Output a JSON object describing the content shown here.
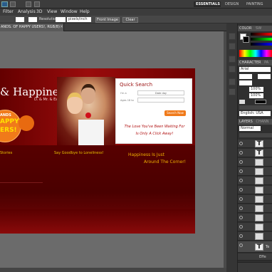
{
  "app": {
    "menu": [
      "Filter",
      "Analysis",
      "3D",
      "View",
      "Window",
      "Help"
    ],
    "workspaces": [
      "ESSENTIALS",
      "DESIGN",
      "PAINTING"
    ],
    "zoom": "66.7"
  },
  "options": {
    "resolution_label": "Resolution:",
    "unit": "pixels/inch",
    "front_image": "Front Image",
    "clear": "Clear"
  },
  "document": {
    "tab_title": "ANDS. OF HAPPY USERS!, RGB/8)",
    "close": "×"
  },
  "web": {
    "logo_main": "& Happiness",
    "logo_sub": "D. & Mr. & Eazy",
    "badge_lines": [
      "ANDS",
      "APPY",
      "ERS!"
    ],
    "quick_search_title": "Quick Search",
    "field1_label": "I'm a",
    "field1_value": "Date day",
    "field2_label": "Ages 18 to",
    "search_button": "Search Now",
    "slogan_lines": [
      "The Love You've Been Waiting For",
      "Is Only A Click Away!"
    ],
    "stories": "Stories",
    "goodbye": "Say Goodbye to Loneliness!",
    "happiness_lines": [
      "Happiness Is Just",
      "Around The Corner!"
    ]
  },
  "panels": {
    "color_tab": "COLOR",
    "swatches_tab": "SW",
    "character_tab": "CHARACTER",
    "para_tab": "PA",
    "font": "Arial",
    "size_percent": "100%",
    "scale_percent": "100%",
    "language": "English: USA",
    "layers_tab": "LAYERS",
    "channels_tab": "CHANN",
    "blend_mode": "Normal",
    "effects": "Effe",
    "last_layer": "Te"
  },
  "colors": {
    "accent_red": "#8b0a0a",
    "dark_red": "#5a0000",
    "orange": "#f07a1a",
    "gold": "#e8c000"
  }
}
